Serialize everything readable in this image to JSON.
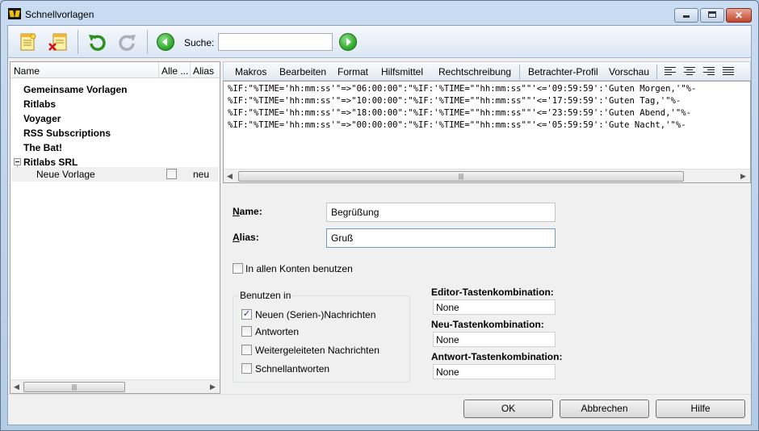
{
  "window": {
    "title": "Schnellvorlagen"
  },
  "toolbar": {
    "search_label": "Suche:",
    "search_value": ""
  },
  "list": {
    "columns": [
      "Name",
      "Alle ...",
      "Alias"
    ],
    "items": [
      {
        "label": "Gemeinsame Vorlagen"
      },
      {
        "label": "Ritlabs"
      },
      {
        "label": "Voyager"
      },
      {
        "label": "RSS Subscriptions"
      },
      {
        "label": "The Bat!"
      },
      {
        "label": "Ritlabs SRL"
      }
    ],
    "child": {
      "label": "Neue Vorlage",
      "checked": false,
      "alias": "neu"
    }
  },
  "menu": [
    "Makros",
    "Bearbeiten",
    "Format",
    "Hilfsmittel",
    "Rechtschreibung",
    "Betrachter-Profil",
    "Vorschau"
  ],
  "editor": {
    "lines": [
      "%IF:\"%TIME='hh:mm:ss'\"=>\"06:00:00\":\"%IF:'%TIME=\"\"hh:mm:ss\"\"'<='09:59:59':'Guten Morgen,'\"%-",
      "%IF:\"%TIME='hh:mm:ss'\"=>\"10:00:00\":\"%IF:'%TIME=\"\"hh:mm:ss\"\"'<='17:59:59':'Guten Tag,'\"%-",
      "%IF:\"%TIME='hh:mm:ss'\"=>\"18:00:00\":\"%IF:'%TIME=\"\"hh:mm:ss\"\"'<='23:59:59':'Guten Abend,'\"%-",
      "%IF:\"%TIME='hh:mm:ss'\"=>\"00:00:00\":\"%IF:'%TIME=\"\"hh:mm:ss\"\"'<='05:59:59':'Gute Nacht,'\"%-"
    ]
  },
  "form": {
    "name_label": "Name:",
    "name_value": "Begrüßung",
    "alias_label": "Alias:",
    "alias_value": "Gruß",
    "all_accounts_label": "In allen Konten benutzen",
    "all_accounts_checked": false,
    "use_in_title": "Benutzen in",
    "use_in": [
      {
        "label": "Neuen (Serien-)Nachrichten",
        "checked": true
      },
      {
        "label": "Antworten",
        "checked": false
      },
      {
        "label": "Weitergeleiteten Nachrichten",
        "checked": false
      },
      {
        "label": "Schnellantworten",
        "checked": false
      }
    ],
    "hotkeys": [
      {
        "label": "Editor-Tastenkombination:",
        "value": "None"
      },
      {
        "label": "Neu-Tastenkombination:",
        "value": "None"
      },
      {
        "label": "Antwort-Tastenkombination:",
        "value": "None"
      }
    ]
  },
  "buttons": {
    "ok": "OK",
    "cancel": "Abbrechen",
    "help": "Hilfe"
  },
  "colors": {
    "title_bar": "#c9dcf1",
    "close_button": "#c1462c",
    "go_button": "#27a423"
  }
}
